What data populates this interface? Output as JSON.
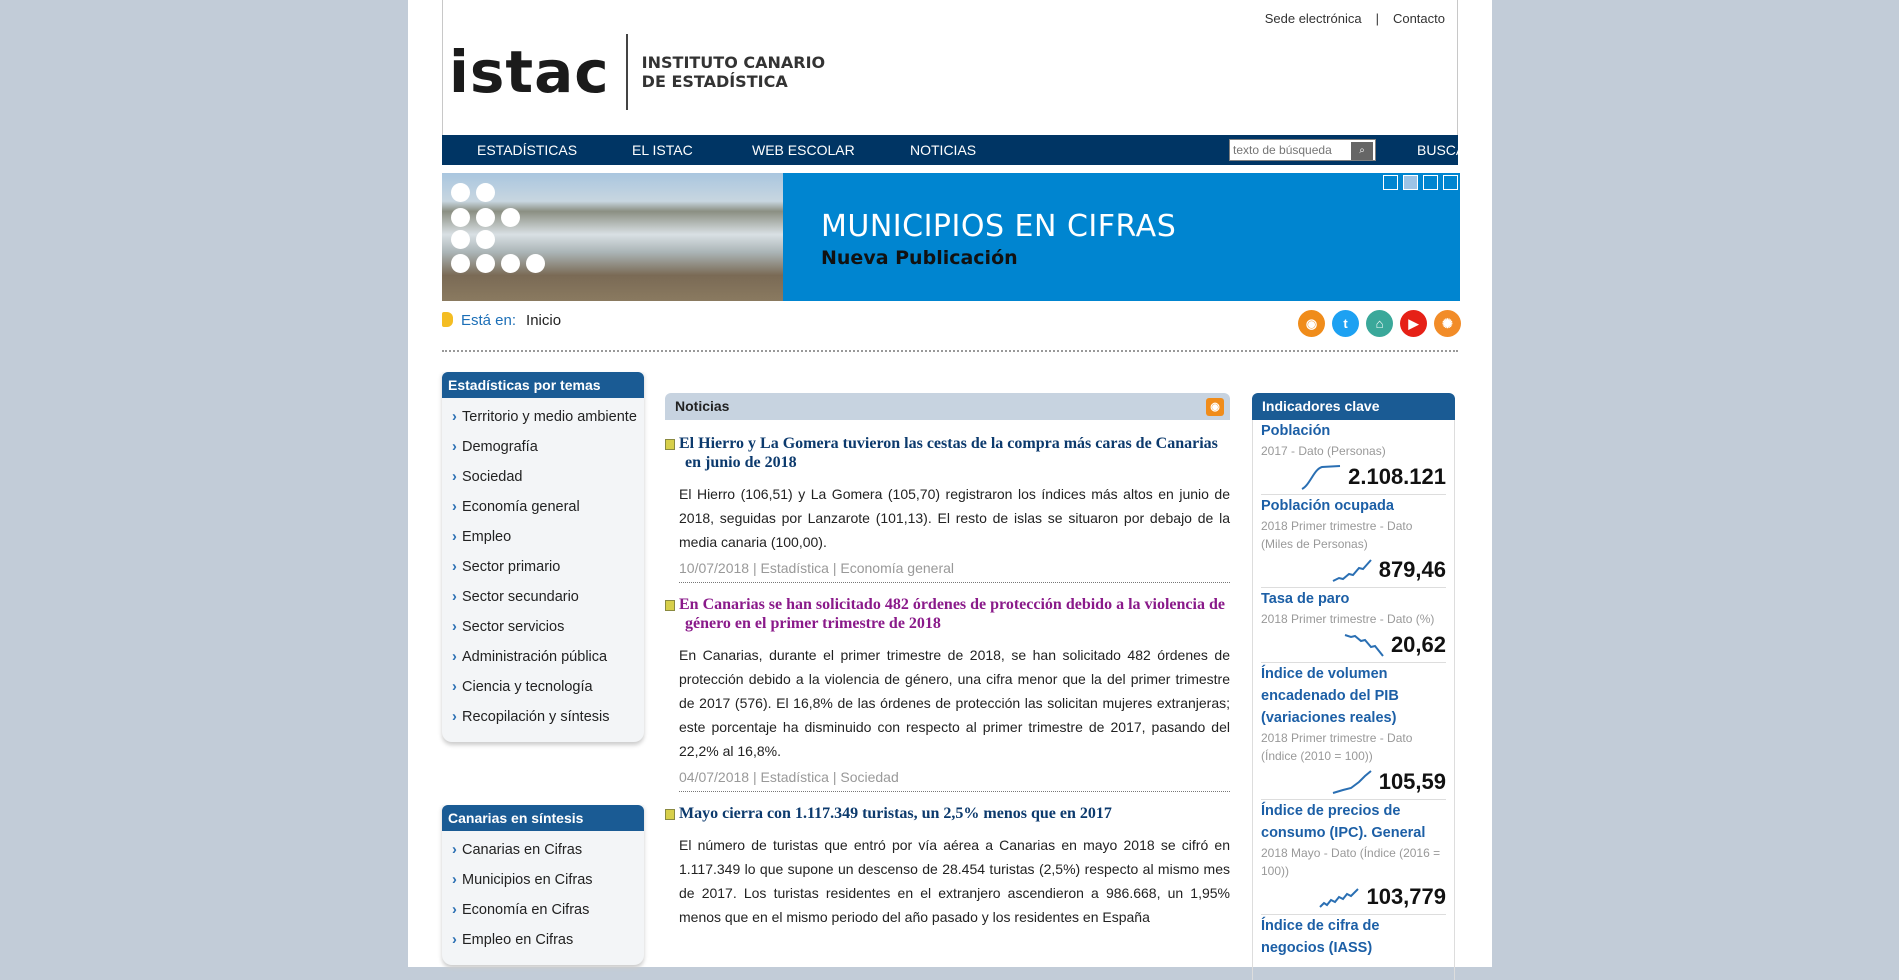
{
  "header": {
    "links": [
      "Sede electrónica",
      "Contacto"
    ],
    "separator": "|",
    "logo_word": "istac",
    "logo_line1": "INSTITUTO CANARIO",
    "logo_line2": "DE ESTADÍSTICA"
  },
  "nav": {
    "items": [
      "ESTADÍSTICAS",
      "EL ISTAC",
      "WEB ESCOLAR",
      "NOTICIAS"
    ],
    "search_placeholder": "texto de búsqueda",
    "search_button": "BUSCAR"
  },
  "banner": {
    "title": "MUNICIPIOS EN CIFRAS",
    "subtitle": "Nueva Publicación",
    "pages": 4,
    "active_page": 2
  },
  "breadcrumb": {
    "label": "Está en:",
    "current": "Inicio"
  },
  "social": {
    "icons": [
      "rss-icon",
      "twitter-icon",
      "github-icon",
      "youtube-icon",
      "open-data-icon"
    ],
    "colors": [
      "#f08c1a",
      "#1da1f2",
      "#3aa89a",
      "#e62117",
      "#f28c28"
    ]
  },
  "sidebar": {
    "temas_title": "Estadísticas por temas",
    "temas": [
      "Territorio y medio ambiente",
      "Demografía",
      "Sociedad",
      "Economía general",
      "Empleo",
      "Sector primario",
      "Sector secundario",
      "Sector servicios",
      "Administración pública",
      "Ciencia y tecnología",
      "Recopilación y síntesis"
    ],
    "sintesis_title": "Canarias en síntesis",
    "sintesis": [
      "Canarias en Cifras",
      "Municipios en Cifras",
      "Economía en Cifras",
      "Empleo en Cifras"
    ]
  },
  "news": {
    "title": "Noticias",
    "items": [
      {
        "title": "El Hierro y La Gomera tuvieron las cestas de la compra más caras de Canarias en junio de 2018",
        "body": "El Hierro (106,51) y La Gomera (105,70) registraron los índices más altos en junio de 2018, seguidas por Lanzarote (101,13). El resto de islas se situaron por debajo de la media canaria (100,00).",
        "meta": "10/07/2018 | Estadística | Economía general"
      },
      {
        "title": "En Canarias se han solicitado 482 órdenes de protección debido a la violencia de género en el primer trimestre de 2018",
        "body": "En Canarias, durante el primer trimestre de 2018, se han solicitado 482 órdenes de protección debido a la violencia de género, una cifra menor que la del primer trimestre de 2017 (576). El 16,8% de las órdenes de protección las solicitan mujeres extranjeras; este porcentaje ha disminuido con respecto al primer trimestre de 2017, pasando del 22,2% al 16,8%.",
        "meta": "04/07/2018 | Estadística | Sociedad"
      },
      {
        "title": "Mayo cierra con 1.117.349 turistas, un 2,5% menos que en 2017",
        "body": "El número de turistas que entró por vía aérea a Canarias en mayo 2018 se cifró en 1.117.349 lo que supone un descenso de 28.454 turistas (2,5%) respecto al mismo mes de 2017. Los turistas residentes en el extranjero ascendieron a 986.668, un 1,95% menos que en el mismo periodo del año pasado y los residentes en España",
        "meta": ""
      }
    ]
  },
  "indicators": {
    "title": "Indicadores clave",
    "items": [
      {
        "name": "Población",
        "sub": "2017 - Dato (Personas)",
        "value": "2.108.121"
      },
      {
        "name": "Población ocupada",
        "sub": "2018 Primer trimestre - Dato (Miles de Personas)",
        "value": "879,46"
      },
      {
        "name": "Tasa de paro",
        "sub": "2018 Primer trimestre - Dato (%)",
        "value": "20,62"
      },
      {
        "name": "Índice de volumen encadenado del PIB (variaciones reales)",
        "sub": "2018 Primer trimestre - Dato (Índice (2010 = 100))",
        "value": "105,59"
      },
      {
        "name": "Índice de precios de consumo (IPC). General",
        "sub": "2018 Mayo - Dato (Índice (2016 = 100))",
        "value": "103,779"
      },
      {
        "name": "Índice de cifra de negocios (IASS)",
        "sub": "",
        "value": ""
      }
    ]
  }
}
